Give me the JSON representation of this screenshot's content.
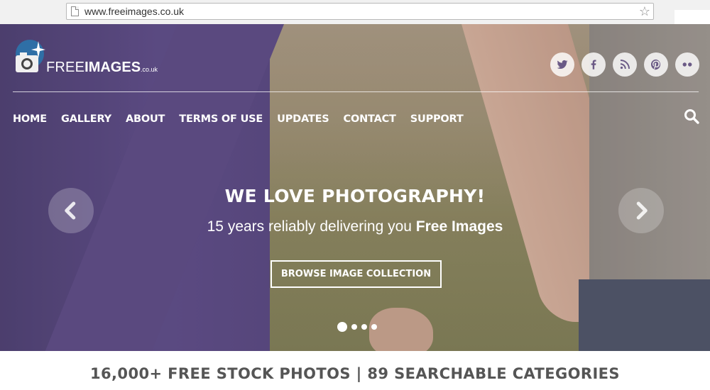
{
  "browser": {
    "url": "www.freeimages.co.uk",
    "icons": [
      "page-icon",
      "star-icon"
    ]
  },
  "site": {
    "logo": {
      "free": "FREE",
      "images": "IMAGES",
      "suffix": ".co.uk"
    },
    "social": [
      "twitter-icon",
      "facebook-icon",
      "rss-icon",
      "pinterest-icon",
      "flickr-icon"
    ],
    "nav": [
      "HOME",
      "GALLERY",
      "ABOUT",
      "TERMS OF USE",
      "UPDATES",
      "CONTACT",
      "SUPPORT"
    ]
  },
  "hero": {
    "headline": "WE LOVE PHOTOGRAPHY!",
    "subline_prefix": "15 years reliably delivering you ",
    "subline_bold": "Free Images",
    "button": "BROWSE IMAGE COLLECTION",
    "slides_count": 4,
    "active_slide": 1
  },
  "stats": {
    "text": "16,000+ FREE STOCK PHOTOS | 89 SEARCHABLE CATEGORIES"
  },
  "colors": {
    "overlay": "#5a4982",
    "text": "#ffffff",
    "stats": "#555555"
  }
}
